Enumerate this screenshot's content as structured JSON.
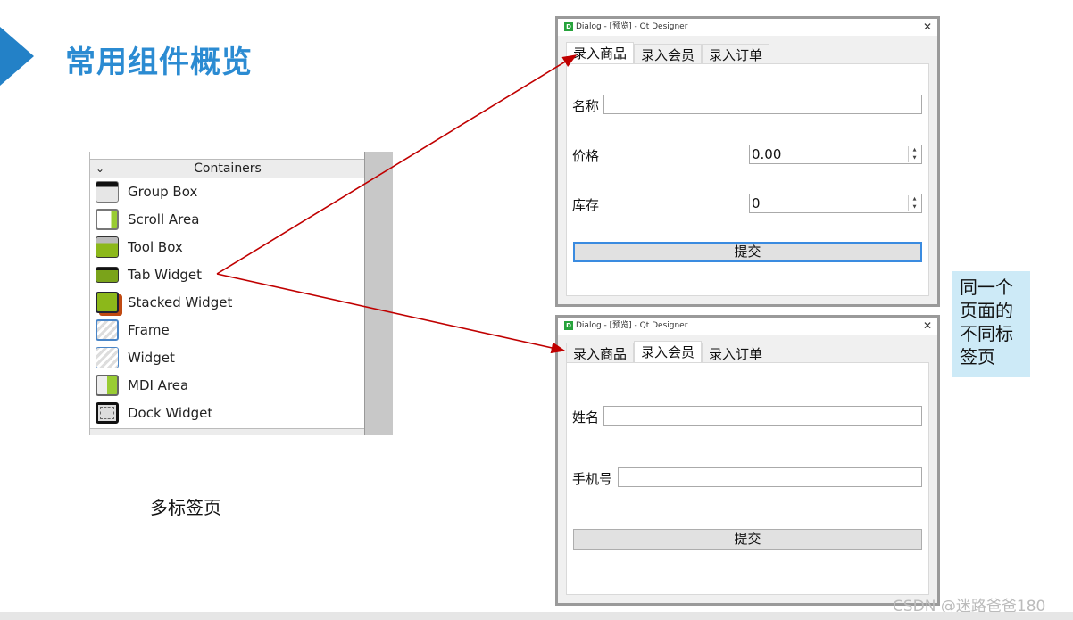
{
  "slide": {
    "title": "常用组件概览",
    "caption": "多标签页",
    "note": "同一个页面的不同标签页",
    "watermark": "CSDN @迷路爸爸180"
  },
  "widget_box": {
    "section": "Containers",
    "items": [
      {
        "label": "Group Box",
        "icon": "group-box-icon"
      },
      {
        "label": "Scroll Area",
        "icon": "scroll-area-icon"
      },
      {
        "label": "Tool Box",
        "icon": "tool-box-icon"
      },
      {
        "label": "Tab Widget",
        "icon": "tab-widget-icon"
      },
      {
        "label": "Stacked Widget",
        "icon": "stacked-widget-icon"
      },
      {
        "label": "Frame",
        "icon": "frame-icon"
      },
      {
        "label": "Widget",
        "icon": "widget-icon"
      },
      {
        "label": "MDI Area",
        "icon": "mdi-area-icon"
      },
      {
        "label": "Dock Widget",
        "icon": "dock-widget-icon"
      }
    ]
  },
  "dialog1": {
    "title": "Dialog - [预览] - Qt Designer",
    "tabs": [
      "录入商品",
      "录入会员",
      "录入订单"
    ],
    "active_tab": 0,
    "fields": {
      "name_label": "名称",
      "name_value": "",
      "price_label": "价格",
      "price_value": "0.00",
      "stock_label": "库存",
      "stock_value": "0"
    },
    "submit": "提交"
  },
  "dialog2": {
    "title": "Dialog - [预览] - Qt Designer",
    "tabs": [
      "录入商品",
      "录入会员",
      "录入订单"
    ],
    "active_tab": 1,
    "fields": {
      "name_label": "姓名",
      "name_value": "",
      "phone_label": "手机号",
      "phone_value": ""
    },
    "submit": "提交"
  },
  "colors": {
    "accent": "#2b8bd2",
    "arrow": "#c00000",
    "note_bg": "#cdeaf7"
  }
}
